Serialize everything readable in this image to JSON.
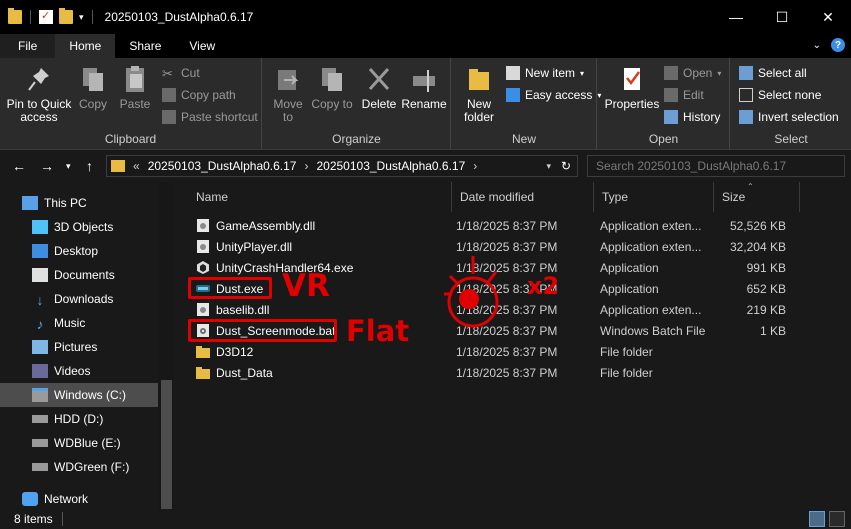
{
  "window": {
    "title": "20250103_DustAlpha0.6.17",
    "controls": {
      "minimize": "—",
      "maximize": "☐",
      "close": "✕"
    }
  },
  "ribbon_tabs": [
    "File",
    "Home",
    "Share",
    "View"
  ],
  "ribbon": {
    "clipboard": {
      "label": "Clipboard",
      "pin_to_quick_access": "Pin to Quick access",
      "copy": "Copy",
      "paste": "Paste",
      "cut": "Cut",
      "copy_path": "Copy path",
      "paste_shortcut": "Paste shortcut"
    },
    "organize": {
      "label": "Organize",
      "move_to": "Move to",
      "copy_to": "Copy to",
      "delete": "Delete",
      "rename": "Rename"
    },
    "new": {
      "label": "New",
      "new_folder": "New folder",
      "new_item": "New item",
      "easy_access": "Easy access"
    },
    "open": {
      "label": "Open",
      "properties": "Properties",
      "open": "Open",
      "edit": "Edit",
      "history": "History"
    },
    "select": {
      "label": "Select",
      "select_all": "Select all",
      "select_none": "Select none",
      "invert_selection": "Invert selection"
    }
  },
  "address_bar": {
    "overflow": "«",
    "crumbs": [
      "20250103_DustAlpha0.6.17",
      "20250103_DustAlpha0.6.17"
    ],
    "search_placeholder": "Search 20250103_DustAlpha0.6.17"
  },
  "nav_pane": [
    {
      "label": "This PC",
      "icon": "pc-icon"
    },
    {
      "label": "3D Objects",
      "icon": "3d-objects-icon"
    },
    {
      "label": "Desktop",
      "icon": "desktop-icon"
    },
    {
      "label": "Documents",
      "icon": "documents-icon"
    },
    {
      "label": "Downloads",
      "icon": "downloads-icon"
    },
    {
      "label": "Music",
      "icon": "music-icon"
    },
    {
      "label": "Pictures",
      "icon": "pictures-icon"
    },
    {
      "label": "Videos",
      "icon": "videos-icon"
    },
    {
      "label": "Windows (C:)",
      "icon": "drive-c-icon",
      "selected": true
    },
    {
      "label": "HDD (D:)",
      "icon": "drive-icon"
    },
    {
      "label": "WDBlue (E:)",
      "icon": "drive-icon"
    },
    {
      "label": "WDGreen (F:)",
      "icon": "drive-icon"
    },
    {
      "label": "Network",
      "icon": "network-icon"
    }
  ],
  "columns": {
    "name": "Name",
    "date": "Date modified",
    "type": "Type",
    "size": "Size"
  },
  "files": [
    {
      "name": "GameAssembly.dll",
      "date": "1/18/2025 8:37 PM",
      "type": "Application exten...",
      "size": "52,526 KB",
      "icon": "dll-icon"
    },
    {
      "name": "UnityPlayer.dll",
      "date": "1/18/2025 8:37 PM",
      "type": "Application exten...",
      "size": "32,204 KB",
      "icon": "dll-icon"
    },
    {
      "name": "UnityCrashHandler64.exe",
      "date": "1/18/2025 8:37 PM",
      "type": "Application",
      "size": "991 KB",
      "icon": "unity-icon"
    },
    {
      "name": "Dust.exe",
      "date": "1/18/2025 8:37 PM",
      "type": "Application",
      "size": "652 KB",
      "icon": "exe-icon"
    },
    {
      "name": "baselib.dll",
      "date": "1/18/2025 8:37 PM",
      "type": "Application exten...",
      "size": "219 KB",
      "icon": "dll-icon"
    },
    {
      "name": "Dust_Screenmode.bat",
      "date": "1/18/2025 8:37 PM",
      "type": "Windows Batch File",
      "size": "1 KB",
      "icon": "bat-icon"
    },
    {
      "name": "D3D12",
      "date": "1/18/2025 8:37 PM",
      "type": "File folder",
      "size": "",
      "icon": "folder-icon"
    },
    {
      "name": "Dust_Data",
      "date": "1/18/2025 8:37 PM",
      "type": "File folder",
      "size": "",
      "icon": "folder-icon"
    }
  ],
  "status": {
    "item_count": "8 items"
  },
  "annotations": {
    "vr": "VR",
    "flat": "Flat",
    "x2": "x2"
  },
  "colors": {
    "annotation": "#e00000",
    "folder": "#e8bb43",
    "accent": "#3a8ee6"
  }
}
